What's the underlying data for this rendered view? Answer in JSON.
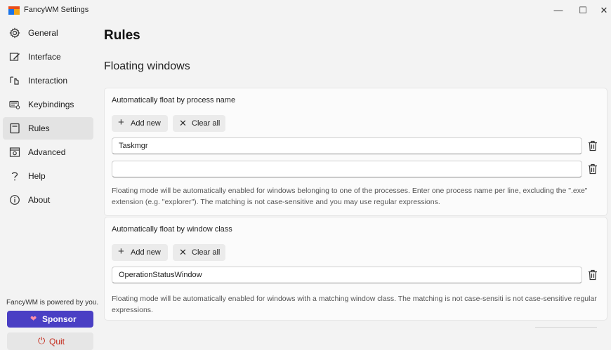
{
  "window": {
    "title": "FancyWM Settings",
    "minimize": "—",
    "maximize": "☐",
    "close": "✕"
  },
  "sidebar": {
    "items": [
      {
        "label": "General",
        "icon": "gear-icon"
      },
      {
        "label": "Interface",
        "icon": "edit-window-icon"
      },
      {
        "label": "Interaction",
        "icon": "pointer-hand-icon"
      },
      {
        "label": "Keybindings",
        "icon": "keyboard-icon"
      },
      {
        "label": "Rules",
        "icon": "rules-icon",
        "active": true
      },
      {
        "label": "Advanced",
        "icon": "advanced-icon"
      },
      {
        "label": "Help",
        "icon": "question-icon"
      },
      {
        "label": "About",
        "icon": "info-icon"
      }
    ],
    "powered_by": "FancyWM is powered by you.",
    "sponsor_label": "Sponsor",
    "quit_label": "Quit"
  },
  "main": {
    "title": "Rules",
    "section_title": "Floating windows",
    "process_card": {
      "heading": "Automatically float by process name",
      "add_label": "Add new",
      "clear_label": "Clear all",
      "entries": [
        "Taskmgr",
        ""
      ],
      "help": "Floating mode will be automatically enabled for windows belonging to one of the processes. Enter one process name per line, excluding the \".exe\" extension (e.g. \"explorer\"). The matching is not case-sensitive and you may use regular expressions."
    },
    "class_card": {
      "heading": "Automatically float by window class",
      "add_label": "Add new",
      "clear_label": "Clear all",
      "entries": [
        "OperationStatusWindow"
      ],
      "help": "Floating mode will be automatically enabled for windows with a matching window class. The matching is not case-sensiti is not case-sensitive regular expressions."
    }
  },
  "colors": {
    "accent": "#4a3fc4",
    "quit": "#c42b1c",
    "active_nav": "#e3e3e3"
  }
}
